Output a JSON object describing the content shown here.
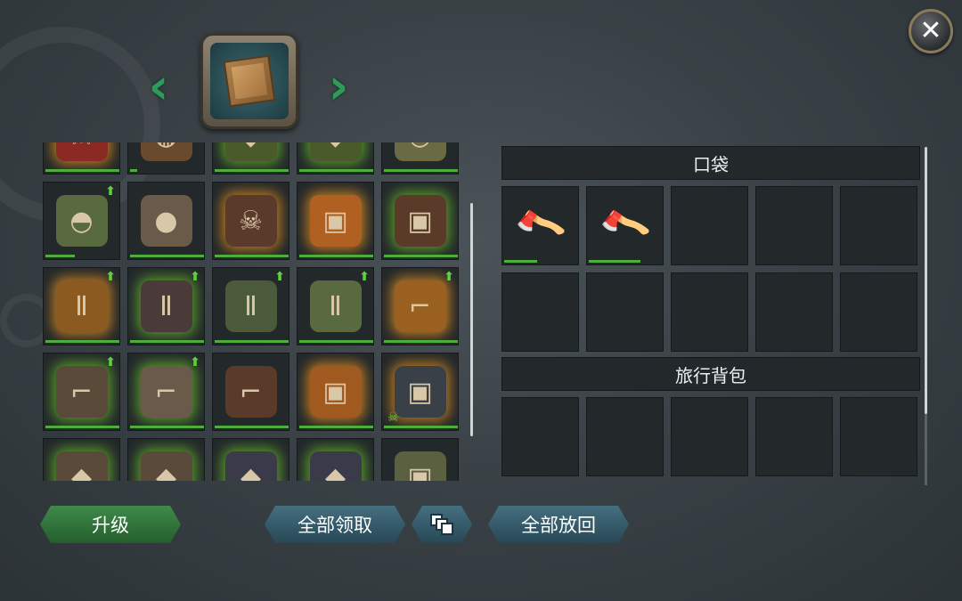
{
  "header": {
    "close_icon": "close-icon",
    "left_arrow_icon": "chevron-left-icon",
    "right_arrow_icon": "chevron-right-icon",
    "container_icon": "wooden-crate-icon"
  },
  "inventory": {
    "items": [
      {
        "icon": "skull-armor-icon",
        "glyph": "☠",
        "color": "#8a2a22",
        "glow": "orange",
        "upgrade": false,
        "durability": 1.0
      },
      {
        "icon": "leather-helmet-icon",
        "glyph": "◍",
        "color": "#6a4a2e",
        "glow": "none",
        "upgrade": false,
        "durability": 0.1
      },
      {
        "icon": "green-armor-icon",
        "glyph": "◆",
        "color": "#4a5a2a",
        "glow": "green",
        "upgrade": false,
        "durability": 1.0
      },
      {
        "icon": "green-armor-icon",
        "glyph": "◆",
        "color": "#4a5a2a",
        "glow": "green",
        "upgrade": false,
        "durability": 1.0
      },
      {
        "icon": "cap-icon",
        "glyph": "◓",
        "color": "#6a6a44",
        "glow": "none",
        "upgrade": false,
        "durability": 1.0
      },
      {
        "icon": "camo-cap-icon",
        "glyph": "◓",
        "color": "#5a6a40",
        "glow": "none",
        "upgrade": true,
        "durability": 0.4
      },
      {
        "icon": "knit-beanie-icon",
        "glyph": "●",
        "color": "#6a5a4a",
        "glow": "none",
        "upgrade": false,
        "durability": 1.0
      },
      {
        "icon": "skull-jacket-icon",
        "glyph": "☠",
        "color": "#5a3a2a",
        "glow": "orange",
        "upgrade": false,
        "durability": 1.0
      },
      {
        "icon": "orange-vest-icon",
        "glyph": "▣",
        "color": "#b06020",
        "glow": "orange",
        "upgrade": false,
        "durability": 1.0
      },
      {
        "icon": "brown-jacket-icon",
        "glyph": "▣",
        "color": "#5a3a28",
        "glow": "green",
        "upgrade": false,
        "durability": 1.0
      },
      {
        "icon": "orange-pants-icon",
        "glyph": "Ⅱ",
        "color": "#8a5a20",
        "glow": "orange",
        "upgrade": true,
        "durability": 1.0
      },
      {
        "icon": "dark-pants-icon",
        "glyph": "Ⅱ",
        "color": "#4a3a3a",
        "glow": "green",
        "upgrade": true,
        "durability": 1.0
      },
      {
        "icon": "green-pants-icon",
        "glyph": "Ⅱ",
        "color": "#4a5a3a",
        "glow": "none",
        "upgrade": true,
        "durability": 1.0
      },
      {
        "icon": "camo-pants-icon",
        "glyph": "Ⅱ",
        "color": "#5a6a40",
        "glow": "none",
        "upgrade": true,
        "durability": 1.0
      },
      {
        "icon": "orange-boots-icon",
        "glyph": "⌐",
        "color": "#9a6020",
        "glow": "orange",
        "upgrade": true,
        "durability": 1.0
      },
      {
        "icon": "spiked-boots-icon",
        "glyph": "⌐",
        "color": "#5a4a3a",
        "glow": "green",
        "upgrade": true,
        "durability": 1.0
      },
      {
        "icon": "sneakers-icon",
        "glyph": "⌐",
        "color": "#6a5a4a",
        "glow": "green",
        "upgrade": true,
        "durability": 1.0
      },
      {
        "icon": "brown-boots-icon",
        "glyph": "⌐",
        "color": "#5a3a28",
        "glow": "none",
        "upgrade": false,
        "durability": 1.0
      },
      {
        "icon": "orange-tactical-vest-icon",
        "glyph": "▣",
        "color": "#a05a20",
        "glow": "orange",
        "upgrade": false,
        "durability": 1.0
      },
      {
        "icon": "dark-armor-skull-icon",
        "glyph": "▣",
        "color": "#3a4048",
        "glow": "orange",
        "upgrade": false,
        "durability": 1.0,
        "skull": true
      },
      {
        "icon": "armor-chest-icon",
        "glyph": "◆",
        "color": "#5a4a3a",
        "glow": "green",
        "upgrade": false,
        "durability": 1.0
      },
      {
        "icon": "armor-chest-icon",
        "glyph": "◆",
        "color": "#5a4a3a",
        "glow": "green",
        "upgrade": false,
        "durability": 1.0
      },
      {
        "icon": "armor-chest-icon",
        "glyph": "◆",
        "color": "#3a3a4a",
        "glow": "green",
        "upgrade": false,
        "durability": 1.0
      },
      {
        "icon": "armor-chest-icon",
        "glyph": "◆",
        "color": "#3a3a4a",
        "glow": "green",
        "upgrade": false,
        "durability": 1.0
      },
      {
        "icon": "hoodie-icon",
        "glyph": "▣",
        "color": "#5a6040",
        "glow": "none",
        "upgrade": false,
        "durability": 1.0
      }
    ]
  },
  "pocket": {
    "title": "口袋",
    "slots": [
      {
        "icon": "axe-icon",
        "durability": 0.45
      },
      {
        "icon": "axe-icon",
        "durability": 0.7
      },
      {},
      {},
      {},
      {},
      {},
      {},
      {},
      {}
    ]
  },
  "backpack": {
    "title": "旅行背包",
    "slots": [
      {},
      {},
      {},
      {},
      {}
    ]
  },
  "buttons": {
    "upgrade": "升级",
    "take_all": "全部领取",
    "stack_icon": "stack-icon",
    "return_all": "全部放回"
  },
  "colors": {
    "durability_bar": "#4caf3a",
    "upgrade_arrow": "#5ed23c",
    "green_button": "#2f7a3a",
    "teal_button": "#36596a"
  }
}
